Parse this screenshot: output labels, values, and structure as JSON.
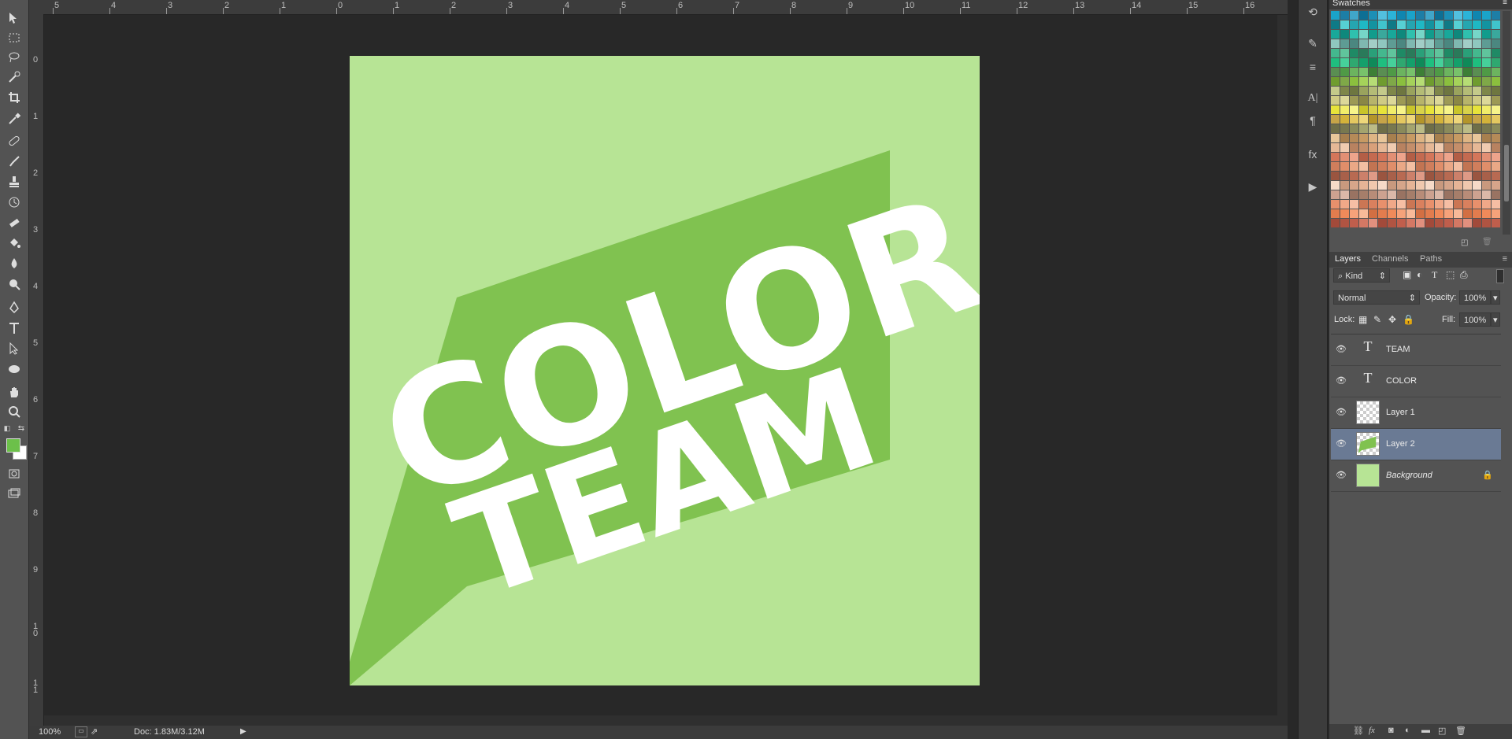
{
  "canvas": {
    "bg_color": "#b7e495",
    "band_color": "#80c250",
    "line1": "COLOR",
    "line2": "TEAM",
    "text_color": "#ffffff"
  },
  "ruler": {
    "top_numbers": [
      "5",
      "4",
      "3",
      "2",
      "1",
      "0",
      "1",
      "2",
      "3",
      "4",
      "5",
      "6",
      "7",
      "8",
      "9",
      "10",
      "11",
      "12",
      "13",
      "14",
      "15",
      "16"
    ],
    "left_numbers": [
      "0",
      "1",
      "2",
      "3",
      "4",
      "5",
      "6",
      "7",
      "8",
      "9",
      "10",
      "11"
    ]
  },
  "status": {
    "zoom": "100%",
    "doc": "Doc: 1.83M/3.12M"
  },
  "swatches": {
    "title": "Swatches"
  },
  "layers_panel": {
    "tabs": [
      "Layers",
      "Channels",
      "Paths"
    ],
    "filter_label": "Kind",
    "blend_mode": "Normal",
    "opacity_label": "Opacity:",
    "opacity_value": "100%",
    "lock_label": "Lock:",
    "fill_label": "Fill:",
    "fill_value": "100%",
    "layers": [
      {
        "name": "TEAM",
        "type": "text",
        "selected": false
      },
      {
        "name": "COLOR",
        "type": "text",
        "selected": false
      },
      {
        "name": "Layer 1",
        "type": "transparent",
        "selected": false
      },
      {
        "name": "Layer 2",
        "type": "shape",
        "selected": true
      },
      {
        "name": "Background",
        "type": "background",
        "selected": false
      }
    ]
  },
  "colors": {
    "foreground": "#6cc04a",
    "background": "#ffffff",
    "selection": "#6a7a94"
  }
}
